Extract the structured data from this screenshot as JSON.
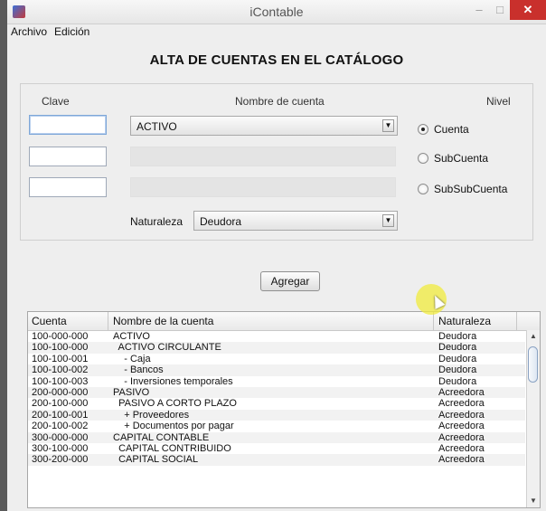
{
  "window": {
    "title": "iContable"
  },
  "menu": [
    "Archivo",
    "Edición"
  ],
  "form": {
    "title": "ALTA DE CUENTAS EN EL CATÁLOGO",
    "headers": {
      "clave": "Clave",
      "nombre": "Nombre de cuenta",
      "nivel": "Nivel"
    },
    "cuenta_select": "ACTIVO",
    "radios": [
      {
        "label": "Cuenta",
        "selected": true
      },
      {
        "label": "SubCuenta",
        "selected": false
      },
      {
        "label": "SubSubCuenta",
        "selected": false
      }
    ],
    "naturaleza_label": "Naturaleza",
    "naturaleza_value": "Deudora",
    "add_button": "Agregar"
  },
  "table": {
    "headers": [
      "Cuenta",
      "Nombre de la cuenta",
      "Naturaleza"
    ],
    "rows": [
      [
        "100-000-000",
        "ACTIVO",
        "Deudora"
      ],
      [
        "100-100-000",
        "  ACTIVO CIRCULANTE",
        "Deudora"
      ],
      [
        "100-100-001",
        "    - Caja",
        "Deudora"
      ],
      [
        "100-100-002",
        "    - Bancos",
        "Deudora"
      ],
      [
        "100-100-003",
        "    - Inversiones temporales",
        "Deudora"
      ],
      [
        "200-000-000",
        "PASIVO",
        "Acreedora"
      ],
      [
        "200-100-000",
        "  PASIVO A CORTO PLAZO",
        "Acreedora"
      ],
      [
        "200-100-001",
        "    + Proveedores",
        "Acreedora"
      ],
      [
        "200-100-002",
        "    + Documentos por pagar",
        "Acreedora"
      ],
      [
        "300-000-000",
        "CAPITAL CONTABLE",
        "Acreedora"
      ],
      [
        "300-100-000",
        "  CAPITAL CONTRIBUIDO",
        "Acreedora"
      ],
      [
        "300-200-000",
        "  CAPITAL SOCIAL",
        "Acreedora"
      ]
    ]
  },
  "icons": {
    "app": "app-icon",
    "minimize": "minimize-icon",
    "maximize": "maximize-icon",
    "close": "close-icon",
    "dropdown": "chevron-down-icon",
    "cursor": "mouse-cursor-icon"
  },
  "colors": {
    "close_button": "#c9302c",
    "cursor_highlight": "#f0eb3c"
  }
}
